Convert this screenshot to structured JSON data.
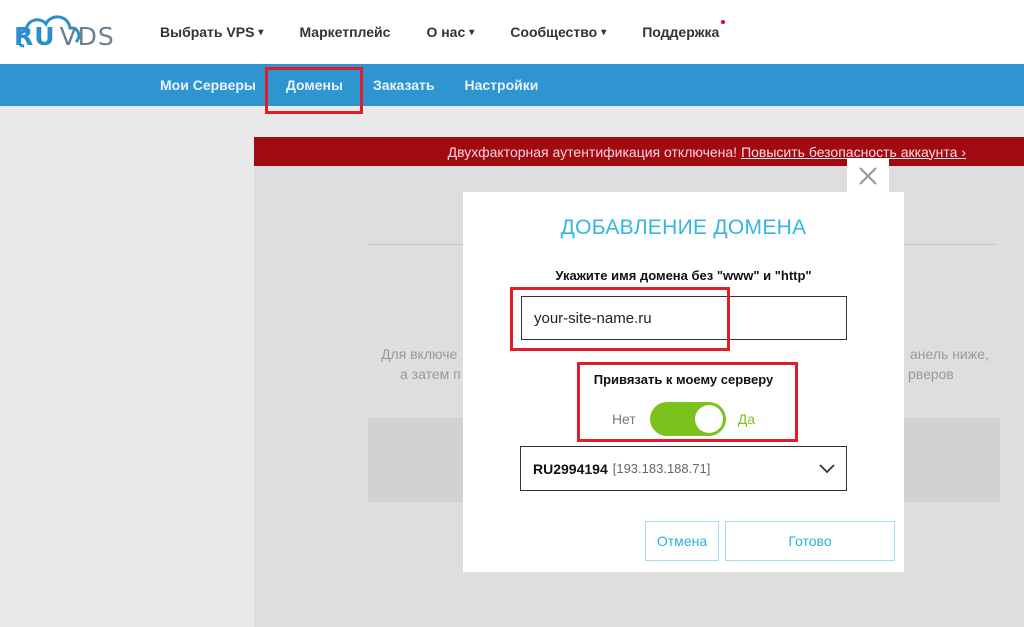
{
  "header": {
    "logo_ru": "RU",
    "logo_vds": "VDS",
    "nav": [
      {
        "label": "Выбрать VPS",
        "has_caret": true
      },
      {
        "label": "Маркетплейс",
        "has_caret": false
      },
      {
        "label": "О нас",
        "has_caret": true
      },
      {
        "label": "Сообщество",
        "has_caret": true
      },
      {
        "label": "Поддержка",
        "has_caret": false
      }
    ],
    "caret": "▾"
  },
  "subnav": {
    "items": [
      {
        "label": "Мои Серверы"
      },
      {
        "label": "Домены"
      },
      {
        "label": "Заказать"
      },
      {
        "label": "Настройки"
      }
    ]
  },
  "alert": {
    "text": "Двухфакторная аутентификация отключена!",
    "link": "Повысить безопасность аккаунта ›"
  },
  "background": {
    "text_left_1": "Для включе",
    "text_left_2": "а затем п",
    "text_right_1": "анель ниже,",
    "text_right_2": "рверов"
  },
  "modal": {
    "title": "ДОБАВЛЕНИЕ ДОМЕНА",
    "domain_label": "Укажите имя домена без \"www\" и \"http\"",
    "domain_value": "your-site-name.ru",
    "bind_label": "Привязать к моему серверу",
    "toggle_off": "Нет",
    "toggle_on": "Да",
    "toggle_state": true,
    "server_name": "RU2994194",
    "server_ip": "[193.183.188.71]",
    "cancel_label": "Отмена",
    "done_label": "Готово"
  },
  "colors": {
    "accent_blue": "#2f95d0",
    "title_blue": "#33b5e5",
    "alert_red": "#a20a12",
    "toggle_green": "#7cc21c",
    "highlight_red": "#e31b2b"
  }
}
